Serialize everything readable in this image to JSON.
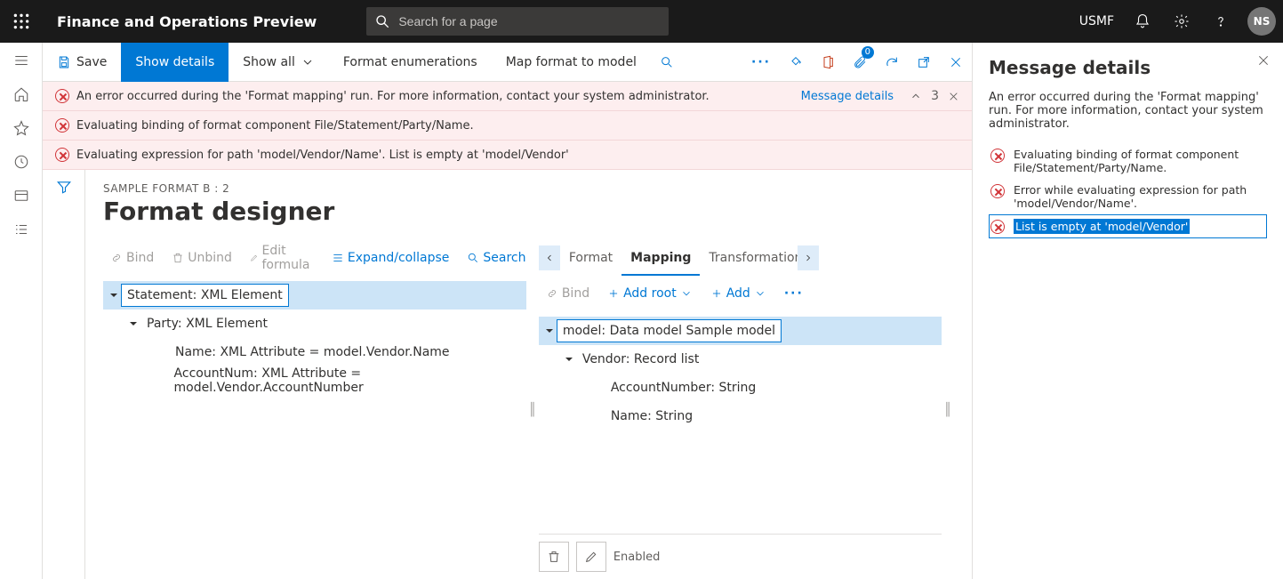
{
  "header": {
    "app_title": "Finance and Operations Preview",
    "search_placeholder": "Search for a page",
    "company": "USMF",
    "avatar": "NS"
  },
  "cmdbar": {
    "save": "Save",
    "show_details": "Show details",
    "show_all": "Show all",
    "format_enums": "Format enumerations",
    "map_format": "Map format to model",
    "attach_badge": "0"
  },
  "errors": {
    "link": "Message details",
    "count": "3",
    "rows": [
      "An error occurred during the 'Format mapping' run. For more information, contact your system administrator.",
      "Evaluating binding of format component File/Statement/Party/Name.",
      "Evaluating expression for path 'model/Vendor/Name'.   List is empty at 'model/Vendor'"
    ]
  },
  "page": {
    "crumb": "SAMPLE FORMAT B : 2",
    "title": "Format designer"
  },
  "left_toolbar": {
    "bind": "Bind",
    "unbind": "Unbind",
    "edit": "Edit formula",
    "expand": "Expand/collapse",
    "search": "Search"
  },
  "left_tree": [
    "Statement: XML Element",
    "Party: XML Element",
    "Name: XML Attribute = model.Vendor.Name",
    "AccountNum: XML Attribute = model.Vendor.AccountNumber"
  ],
  "right_tabs": {
    "format": "Format",
    "mapping": "Mapping",
    "transform": "Transformations"
  },
  "right_toolbar": {
    "bind": "Bind",
    "add_root": "Add root",
    "add": "Add"
  },
  "right_tree": [
    "model: Data model Sample model",
    "Vendor: Record list",
    "AccountNumber: String",
    "Name: String"
  ],
  "prop": {
    "enabled": "Enabled"
  },
  "details": {
    "title": "Message details",
    "desc": "An error occurred during the 'Format mapping' run. For more information, contact your system administrator.",
    "items": [
      "Evaluating binding of format component File/Statement/Party/Name.",
      "Error while evaluating expression for path 'model/Vendor/Name'.",
      "List is empty at 'model/Vendor'"
    ]
  }
}
